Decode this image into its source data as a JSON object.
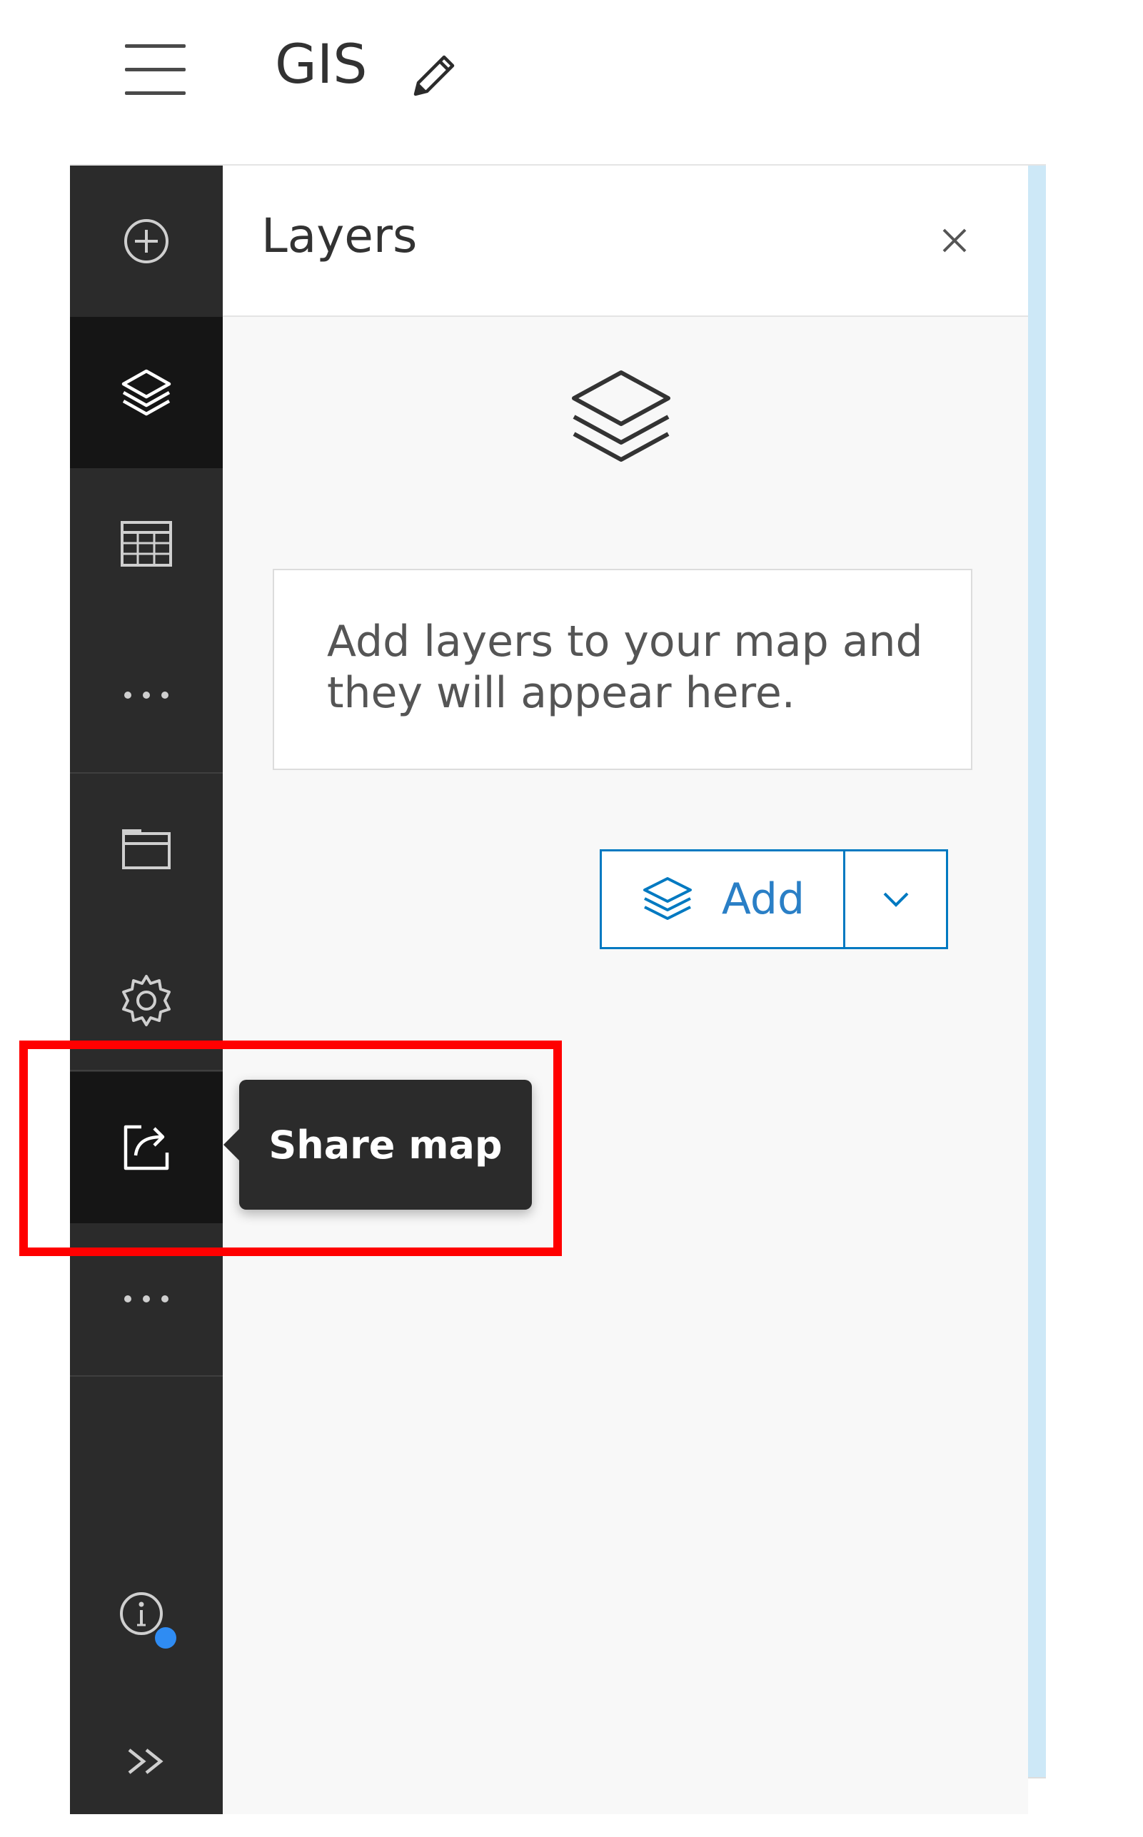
{
  "header": {
    "app_title": "GIS",
    "icons": {
      "menu": "hamburger-menu-icon",
      "edit": "pencil-icon"
    }
  },
  "action_bar": {
    "items": [
      {
        "name": "add-data",
        "icon": "plus-circle-icon"
      },
      {
        "name": "layers",
        "icon": "layers-icon",
        "active": true
      },
      {
        "name": "tables",
        "icon": "table-icon"
      },
      {
        "name": "more-tools",
        "icon": "ellipsis-icon"
      },
      {
        "name": "map-properties",
        "icon": "folder-icon"
      },
      {
        "name": "settings",
        "icon": "gear-icon"
      },
      {
        "name": "share-map",
        "icon": "share-icon",
        "hovered": true
      },
      {
        "name": "more-actions",
        "icon": "ellipsis-icon"
      },
      {
        "name": "info",
        "icon": "info-icon"
      },
      {
        "name": "expand",
        "icon": "double-chevron-right-icon"
      }
    ]
  },
  "panel": {
    "title": "Layers",
    "empty_message": "Add layers to your map and they will appear here.",
    "add_button_label": "Add"
  },
  "tooltip": {
    "text": "Share map"
  },
  "colors": {
    "action_bar": "#2b2b2b",
    "action_active": "#151515",
    "accent": "#0079c1",
    "notification_dot": "#2f8cf3",
    "highlight_box": "#ff0000"
  }
}
